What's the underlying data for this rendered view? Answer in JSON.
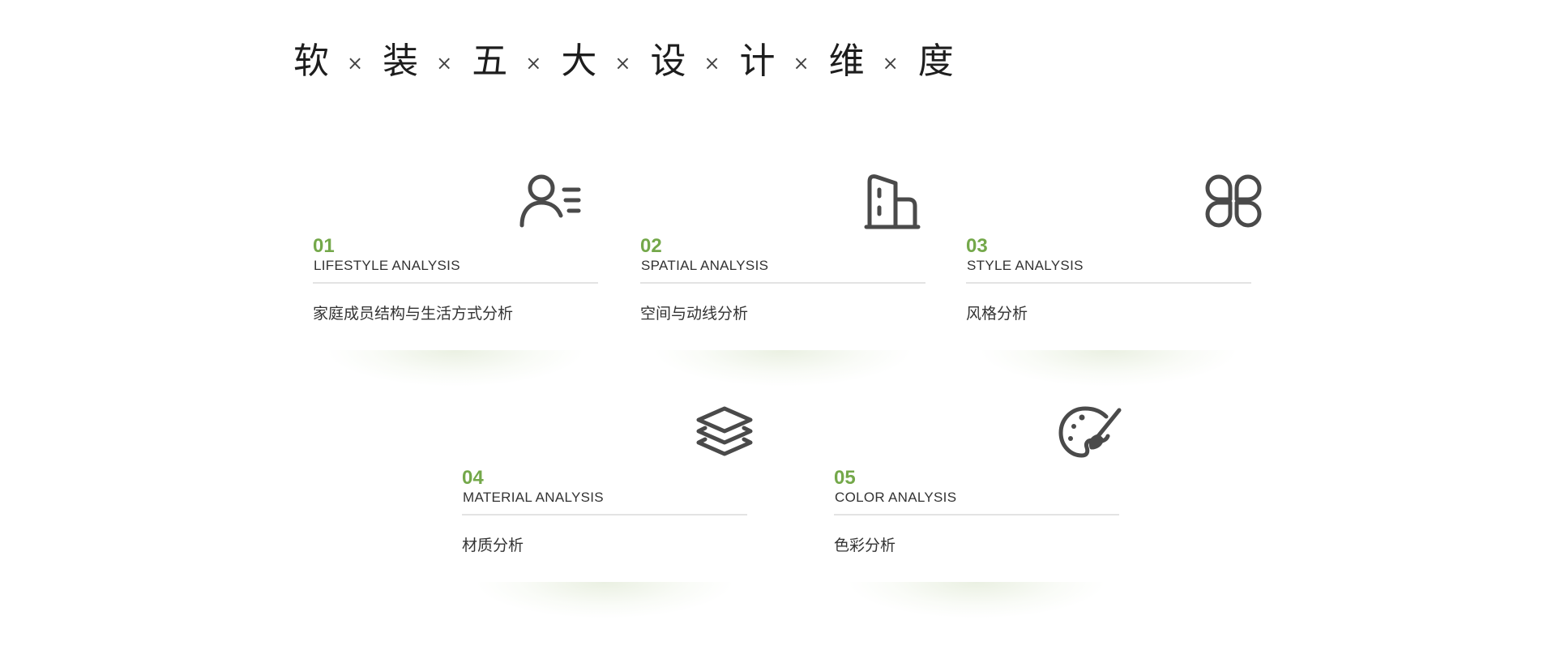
{
  "title": {
    "chars": [
      "软",
      "装",
      "五",
      "大",
      "设",
      "计",
      "维",
      "度"
    ],
    "separator": "×"
  },
  "colors": {
    "accent": "#74a84a",
    "icon": "#4a4a4a",
    "text": "#333333",
    "rule": "#e3e3e3"
  },
  "cards": [
    {
      "num": "01",
      "en": "LIFESTYLE ANALYSIS",
      "cn": "家庭成员结构与生活方式分析",
      "icon": "person-list-icon"
    },
    {
      "num": "02",
      "en": "SPATIAL ANALYSIS",
      "cn": "空间与动线分析",
      "icon": "building-icon"
    },
    {
      "num": "03",
      "en": "STYLE ANALYSIS",
      "cn": "风格分析",
      "icon": "clover-icon"
    },
    {
      "num": "04",
      "en": "MATERIAL ANALYSIS",
      "cn": "材质分析",
      "icon": "layers-icon"
    },
    {
      "num": "05",
      "en": "COLOR ANALYSIS",
      "cn": "色彩分析",
      "icon": "palette-icon"
    }
  ]
}
